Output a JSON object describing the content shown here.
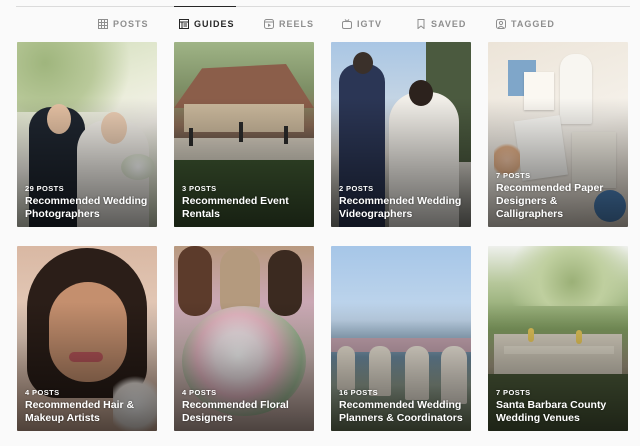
{
  "tabs": [
    {
      "label": "POSTS",
      "icon": "grid-icon"
    },
    {
      "label": "GUIDES",
      "icon": "guide-icon",
      "active": true
    },
    {
      "label": "REELS",
      "icon": "reels-icon"
    },
    {
      "label": "IGTV",
      "icon": "igtv-icon"
    },
    {
      "label": "SAVED",
      "icon": "bookmark-icon"
    },
    {
      "label": "TAGGED",
      "icon": "tag-icon"
    }
  ],
  "guides": [
    {
      "count": "29 POSTS",
      "title": "Recommended Wedding Photographers",
      "scene": "wedding couple embracing in garden"
    },
    {
      "count": "3 POSTS",
      "title": "Recommended Event Rentals",
      "scene": "outdoor reception tables with lanterns"
    },
    {
      "count": "2 POSTS",
      "title": "Recommended Wedding Videographers",
      "scene": "bride and groom walking away"
    },
    {
      "count": "7 POSTS",
      "title": "Recommended Paper Designers & Calligraphers",
      "scene": "wedding invitation flat lay"
    },
    {
      "count": "4 POSTS",
      "title": "Recommended Hair & Makeup Artists",
      "scene": "bride portrait with flowers"
    },
    {
      "count": "4 POSTS",
      "title": "Recommended Floral Designers",
      "scene": "bridal bouquet with bridesmaids"
    },
    {
      "count": "16 POSTS",
      "title": "Recommended Wedding Planners & Coordinators",
      "scene": "ocean view ceremony chairs"
    },
    {
      "count": "7 POSTS",
      "title": "Santa Barbara County Wedding Venues",
      "scene": "garden table under trees"
    }
  ]
}
